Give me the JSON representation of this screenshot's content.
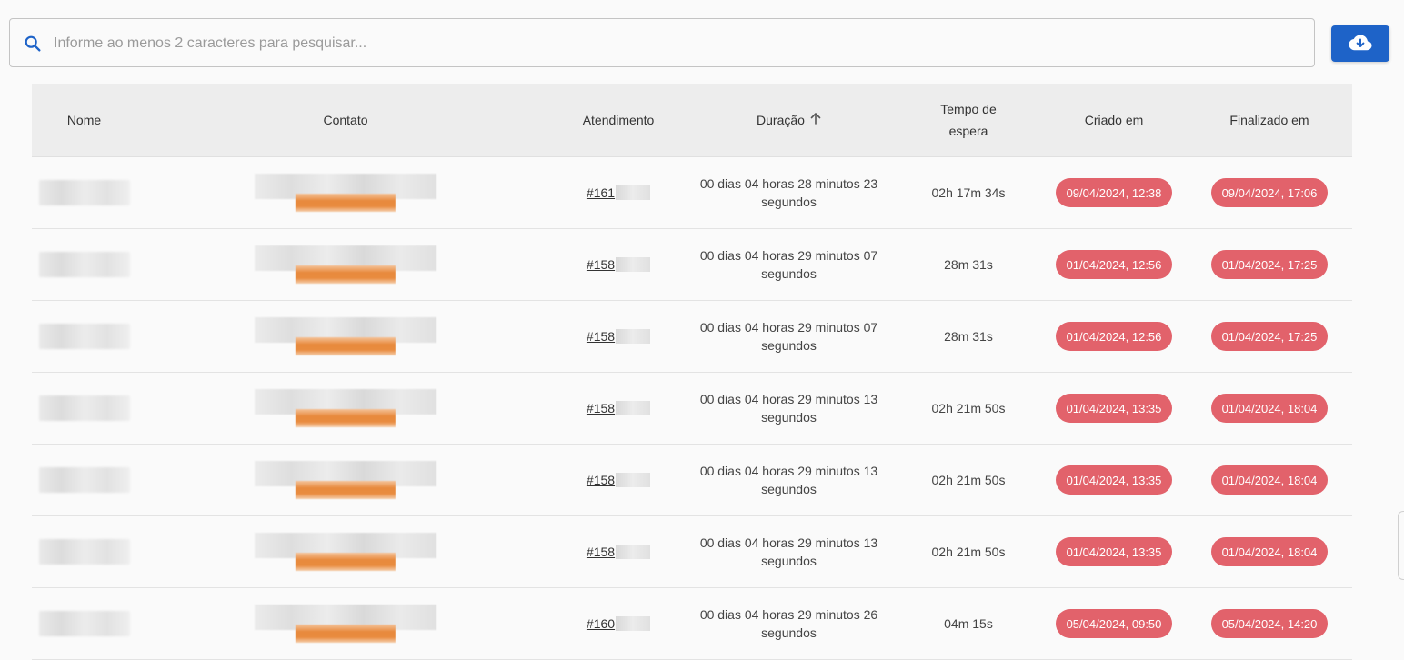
{
  "search": {
    "placeholder": "Informe ao menos 2 caracteres para pesquisar..."
  },
  "icons": {
    "search": "search-icon",
    "download": "cloud-download-icon",
    "sort": "arrow-up-icon"
  },
  "colors": {
    "accent": "#1e63c8",
    "badge": "#e2626b"
  },
  "table": {
    "headers": {
      "nome": "Nome",
      "contato": "Contato",
      "atendimento": "Atendimento",
      "duracao": "Duração",
      "tempo_espera": "Tempo de espera",
      "criado_em": "Criado em",
      "finalizado_em": "Finalizado em"
    },
    "sort": {
      "column": "duracao",
      "direction": "asc"
    },
    "rows": [
      {
        "atendimento": "#161",
        "duracao": "00 dias 04 horas 28 minutos 23 segundos",
        "tempo_espera": "02h 17m 34s",
        "criado_em": "09/04/2024, 12:38",
        "finalizado_em": "09/04/2024, 17:06"
      },
      {
        "atendimento": "#158",
        "duracao": "00 dias 04 horas 29 minutos 07 segundos",
        "tempo_espera": "28m 31s",
        "criado_em": "01/04/2024, 12:56",
        "finalizado_em": "01/04/2024, 17:25"
      },
      {
        "atendimento": "#158",
        "duracao": "00 dias 04 horas 29 minutos 07 segundos",
        "tempo_espera": "28m 31s",
        "criado_em": "01/04/2024, 12:56",
        "finalizado_em": "01/04/2024, 17:25"
      },
      {
        "atendimento": "#158",
        "duracao": "00 dias 04 horas 29 minutos 13 segundos",
        "tempo_espera": "02h 21m 50s",
        "criado_em": "01/04/2024, 13:35",
        "finalizado_em": "01/04/2024, 18:04"
      },
      {
        "atendimento": "#158",
        "duracao": "00 dias 04 horas 29 minutos 13 segundos",
        "tempo_espera": "02h 21m 50s",
        "criado_em": "01/04/2024, 13:35",
        "finalizado_em": "01/04/2024, 18:04"
      },
      {
        "atendimento": "#158",
        "duracao": "00 dias 04 horas 29 minutos 13 segundos",
        "tempo_espera": "02h 21m 50s",
        "criado_em": "01/04/2024, 13:35",
        "finalizado_em": "01/04/2024, 18:04"
      },
      {
        "atendimento": "#160",
        "duracao": "00 dias 04 horas 29 minutos 26 segundos",
        "tempo_espera": "04m 15s",
        "criado_em": "05/04/2024, 09:50",
        "finalizado_em": "05/04/2024, 14:20"
      }
    ]
  }
}
